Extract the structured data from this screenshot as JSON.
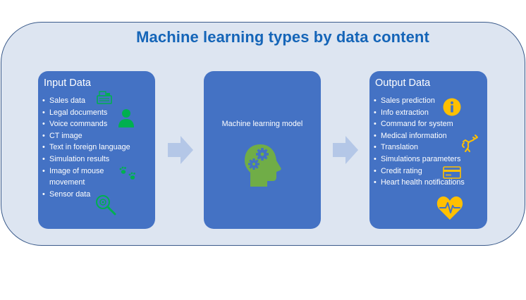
{
  "title": "Machine learning types by data content",
  "input": {
    "heading": "Input Data",
    "items": [
      "Sales data",
      "Legal documents",
      "Voice commands",
      "CT image",
      "Text in foreign language",
      "Simulation results",
      "Image of mouse movement",
      "Sensor data"
    ]
  },
  "model": {
    "heading": "Machine learning model"
  },
  "output": {
    "heading": "Output Data",
    "items": [
      "Sales prediction",
      "Info extraction",
      "Command for system",
      "Medical information",
      "Translation",
      "Simulations parameters",
      "Credit rating",
      "Heart health notifications"
    ]
  },
  "colors": {
    "panel": "#4472c4",
    "frame": "#dde5f1",
    "title": "#1565b8",
    "input_icons": "#00b050",
    "model_icon": "#70ad47",
    "output_icons": "#ffc000",
    "arrow": "#b4c7e7"
  },
  "icons": {
    "input": [
      "cash-register-icon",
      "person-icon",
      "paw-prints-icon",
      "sensor-search-icon"
    ],
    "model": "head-gears-icon",
    "output": [
      "info-icon",
      "dragon-icon",
      "credit-card-icon",
      "heart-rate-icon"
    ]
  }
}
